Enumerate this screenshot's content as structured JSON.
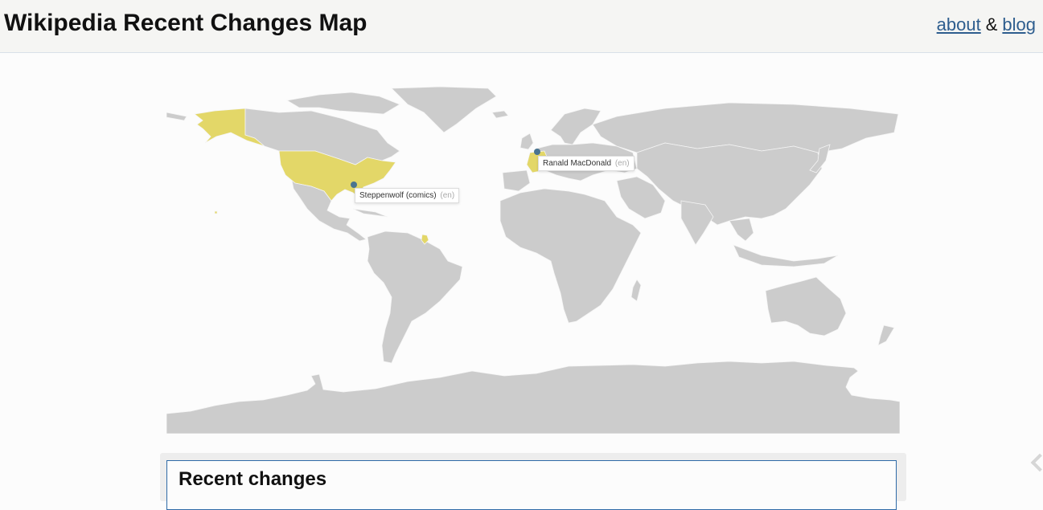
{
  "header": {
    "title": "Wikipedia Recent Changes Map",
    "links": {
      "about": "about",
      "separator": "&",
      "blog": "blog"
    }
  },
  "map": {
    "colors": {
      "land": "#cccccc",
      "highlight": "#e3d768",
      "marker": "#4a7490",
      "border": "#f5f5f5"
    },
    "highlighted_regions": [
      "United States",
      "France",
      "French Guiana"
    ],
    "edits": [
      {
        "title": "Steppenwolf (comics)",
        "lang": "(en)",
        "region": "United States"
      },
      {
        "title": "Ranald MacDonald",
        "lang": "(en)",
        "region": "France"
      }
    ]
  },
  "recent_changes": {
    "heading": "Recent changes"
  }
}
